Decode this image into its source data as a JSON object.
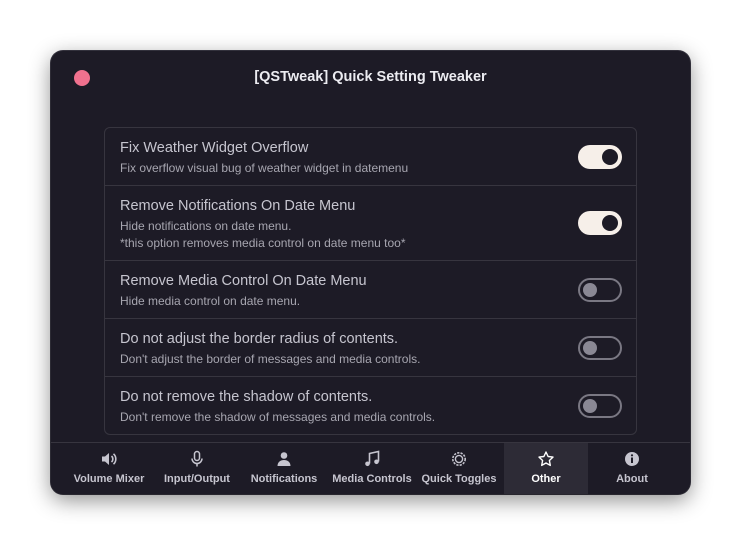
{
  "window": {
    "title": "[QSTweak] Quick Setting Tweaker"
  },
  "settings": [
    {
      "title": "Fix Weather Widget Overflow",
      "subtitle": "Fix overflow visual bug of weather widget in datemenu",
      "enabled": true
    },
    {
      "title": "Remove Notifications On Date Menu",
      "subtitle": "Hide notifications on date menu.",
      "subtitle2": "*this option removes media control on date menu too*",
      "enabled": true
    },
    {
      "title": "Remove Media Control On Date Menu",
      "subtitle": "Hide media control on date menu.",
      "enabled": false
    },
    {
      "title": "Do not adjust the border radius of contents.",
      "subtitle": "Don't adjust the border of messages and media controls.",
      "enabled": false
    },
    {
      "title": "Do not remove the shadow of contents.",
      "subtitle": "Don't remove the shadow of messages and media controls.",
      "enabled": false
    }
  ],
  "tabs": [
    {
      "label": "Volume Mixer",
      "icon": "speaker-icon"
    },
    {
      "label": "Input/Output",
      "icon": "microphone-icon"
    },
    {
      "label": "Notifications",
      "icon": "person-icon"
    },
    {
      "label": "Media Controls",
      "icon": "music-note-icon"
    },
    {
      "label": "Quick Toggles",
      "icon": "gear-icon"
    },
    {
      "label": "Other",
      "icon": "star-icon",
      "active": true
    },
    {
      "label": "About",
      "icon": "info-icon"
    }
  ],
  "colors": {
    "close": "#f0718e",
    "window_bg": "#1d1b26",
    "toggle_on": "#f6efe9",
    "active_tab": "#2d2b36"
  }
}
